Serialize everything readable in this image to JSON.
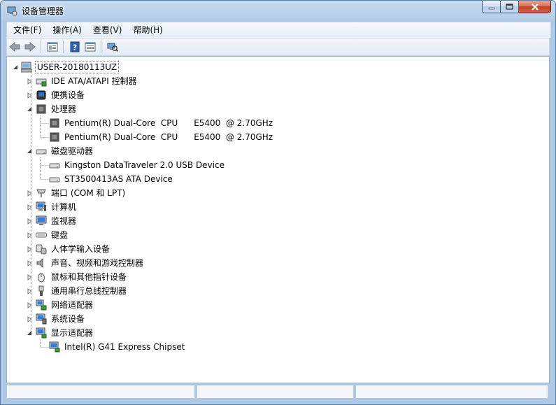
{
  "window": {
    "title": "设备管理器"
  },
  "menu": [
    "文件(F)",
    "操作(A)",
    "查看(V)",
    "帮助(H)"
  ],
  "toolbar": [
    "back-icon",
    "forward-icon",
    "properties-icon",
    "help-icon",
    "view-icon",
    "scan-hardware-icon"
  ],
  "tree": {
    "root": "USER-20180113UZ",
    "categories": [
      {
        "label": "IDE ATA/ATAPI 控制器",
        "icon": "ide-controller-icon",
        "expanded": false
      },
      {
        "label": "便携设备",
        "icon": "portable-device-icon",
        "expanded": false
      },
      {
        "label": "处理器",
        "icon": "processor-icon",
        "expanded": true,
        "children": [
          "Pentium(R) Dual-Core  CPU      E5400  @ 2.70GHz",
          "Pentium(R) Dual-Core  CPU      E5400  @ 2.70GHz"
        ]
      },
      {
        "label": "磁盘驱动器",
        "icon": "disk-drive-icon",
        "expanded": true,
        "children": [
          "Kingston DataTraveler 2.0 USB Device",
          "ST3500413AS ATA Device"
        ]
      },
      {
        "label": "端口 (COM 和 LPT)",
        "icon": "port-icon",
        "expanded": false
      },
      {
        "label": "计算机",
        "icon": "computer-icon",
        "expanded": false
      },
      {
        "label": "监视器",
        "icon": "monitor-icon",
        "expanded": false
      },
      {
        "label": "键盘",
        "icon": "keyboard-icon",
        "expanded": false
      },
      {
        "label": "人体学输入设备",
        "icon": "hid-icon",
        "expanded": false
      },
      {
        "label": "声音、视频和游戏控制器",
        "icon": "sound-icon",
        "expanded": false
      },
      {
        "label": "鼠标和其他指针设备",
        "icon": "mouse-icon",
        "expanded": false
      },
      {
        "label": "通用串行总线控制器",
        "icon": "usb-icon",
        "expanded": false
      },
      {
        "label": "网络适配器",
        "icon": "network-adapter-icon",
        "expanded": false
      },
      {
        "label": "系统设备",
        "icon": "system-device-icon",
        "expanded": false
      },
      {
        "label": "显示适配器",
        "icon": "display-adapter-icon",
        "expanded": true,
        "children": [
          "Intel(R) G41 Express Chipset"
        ]
      }
    ]
  },
  "colors": {
    "titlebar": "#b9d1ea",
    "close_button": "#c7462e",
    "tree_background": "#ffffff"
  }
}
